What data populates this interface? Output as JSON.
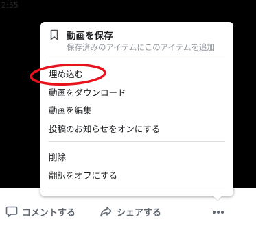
{
  "video": {
    "timestamp": "2:55"
  },
  "menu": {
    "save": {
      "title": "動画を保存",
      "subtitle": "保存済みのアイテムにこのアイテムを追加",
      "icon": "bookmark-icon"
    },
    "group1": [
      {
        "label": "埋め込む",
        "highlighted": true
      },
      {
        "label": "動画をダウンロード"
      },
      {
        "label": "動画を編集"
      },
      {
        "label": "投稿のお知らせをオンにする"
      }
    ],
    "group2": [
      {
        "label": "削除"
      },
      {
        "label": "翻訳をオフにする"
      }
    ]
  },
  "action_bar": {
    "comment_label": "コメントする",
    "comment_icon": "speech-bubble-icon",
    "share_label": "シェアする",
    "share_icon": "share-arrow-icon",
    "more_icon": "more-dots-icon"
  },
  "colors": {
    "highlight": "#e8121d",
    "video_background": "#000000",
    "action_text": "#606770"
  }
}
